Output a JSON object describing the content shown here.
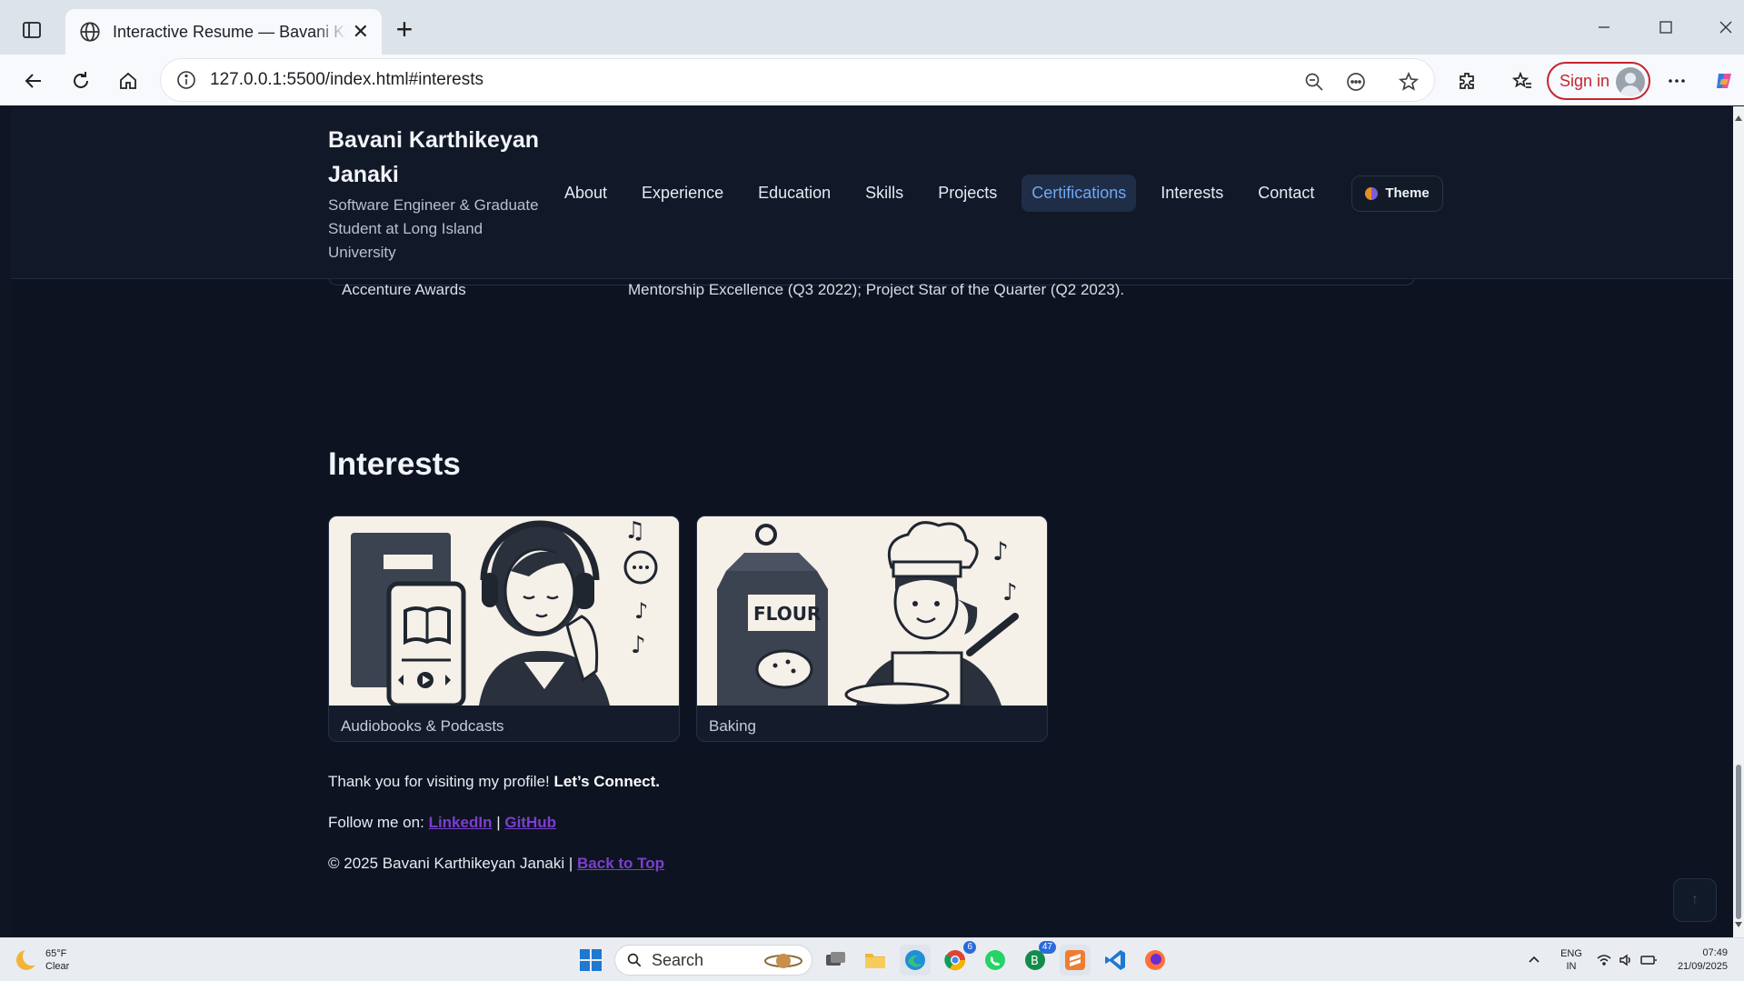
{
  "browser": {
    "tab_title": "Interactive Resume — Bavani Karthikeyan Janaki",
    "url": "127.0.0.1:5500/index.html#interests",
    "signin_label": "Sign in"
  },
  "site": {
    "brand_name": "Bavani Karthikeyan Janaki",
    "brand_subtitle": "Software Engineer & Graduate Student at Long Island University",
    "nav": [
      "About",
      "Experience",
      "Education",
      "Skills",
      "Projects",
      "Certifications",
      "Interests",
      "Contact"
    ],
    "active_nav": "Certifications",
    "theme_label": "Theme"
  },
  "awards": {
    "label": "Accenture Awards",
    "value": "Mentorship Excellence (Q3 2022); Project Star of the Quarter (Q2 2023)."
  },
  "interests": {
    "title": "Interests",
    "cards": [
      {
        "caption": "Audiobooks & Podcasts"
      },
      {
        "caption": "Baking",
        "art_text": "FLOUR"
      }
    ]
  },
  "footer": {
    "thanks": "Thank you for visiting my profile!",
    "connect": "Let’s Connect.",
    "follow_prefix": "Follow me on:",
    "linkedin": "LinkedIn",
    "separator": "|",
    "github": "GitHub",
    "copyright": "© 2025 Bavani Karthikeyan Janaki |",
    "back_to_top": "Back to Top",
    "to_top_button": "↑"
  },
  "taskbar": {
    "temperature": "65°F",
    "condition": "Clear",
    "search_label": "Search",
    "chrome_badge": "6",
    "whatsapp_badge": "47",
    "lang_line1": "ENG",
    "lang_line2": "IN",
    "time": "07:49",
    "date": "21/09/2025"
  },
  "colors": {
    "page_bg": "#0d1320",
    "accent": "#6fa8f7",
    "link": "#7b3fcf"
  }
}
